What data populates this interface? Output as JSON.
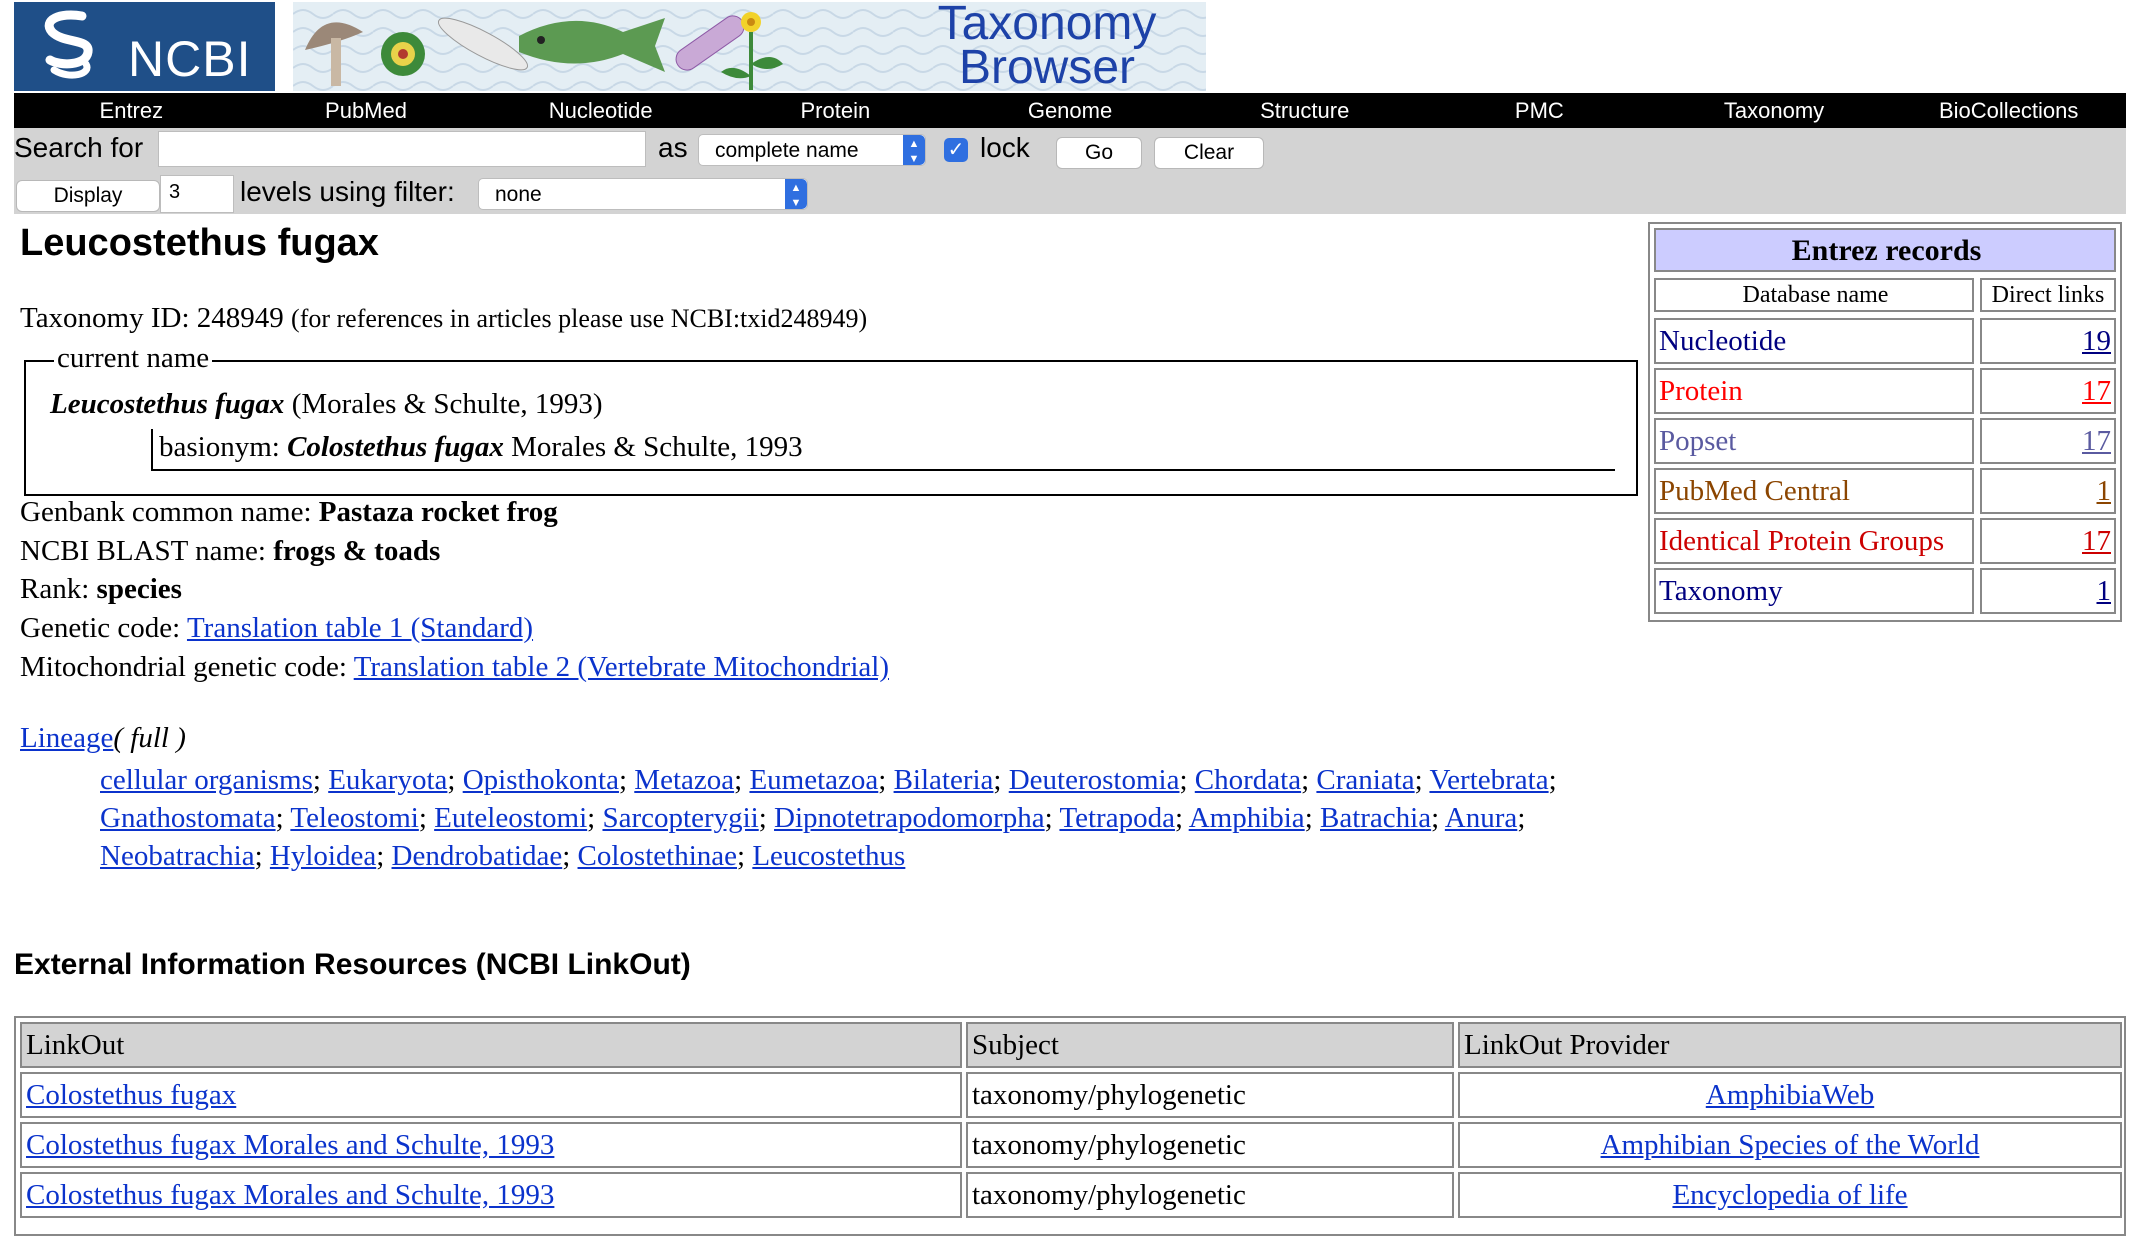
{
  "header": {
    "logo_text": "NCBI",
    "banner_title_line1": "Taxonomy",
    "banner_title_line2": "Browser"
  },
  "nav": {
    "items": [
      "Entrez",
      "PubMed",
      "Nucleotide",
      "Protein",
      "Genome",
      "Structure",
      "PMC",
      "Taxonomy",
      "BioCollections"
    ]
  },
  "search": {
    "label": "Search for",
    "value": "",
    "as_label": "as",
    "as_value": "complete name",
    "lock_label": "lock",
    "lock_checked": true,
    "go_label": "Go",
    "clear_label": "Clear",
    "display_label": "Display",
    "levels_value": "3",
    "levels_label": "levels using filter:",
    "filter_value": "none"
  },
  "taxon": {
    "name": "Leucostethus fugax",
    "taxonomy_id_label": "Taxonomy ID: 248949",
    "taxonomy_id_note": "(for references in articles please use NCBI:txid248949)",
    "current_name_legend": "current name",
    "current_name": "Leucostethus fugax",
    "current_name_authority": "(Morales & Schulte, 1993)",
    "basionym_label": "basionym:",
    "basionym_name": "Colostethus fugax",
    "basionym_authority": "Morales & Schulte, 1993",
    "genbank_label": "Genbank common name:",
    "genbank_value": "Pastaza rocket frog",
    "blast_label": "NCBI BLAST name:",
    "blast_value": "frogs & toads",
    "rank_label": "Rank:",
    "rank_value": "species",
    "genetic_code_label": "Genetic code:",
    "genetic_code_value": "Translation table 1 (Standard)",
    "mito_code_label": "Mitochondrial genetic code:",
    "mito_code_value": "Translation table 2 (Vertebrate Mitochondrial)"
  },
  "lineage": {
    "label": "Lineage",
    "full_label": "( full )",
    "items": [
      "cellular organisms",
      "Eukaryota",
      "Opisthokonta",
      "Metazoa",
      "Eumetazoa",
      "Bilateria",
      "Deuterostomia",
      "Chordata",
      "Craniata",
      "Vertebrata",
      "Gnathostomata",
      "Teleostomi",
      "Euteleostomi",
      "Sarcopterygii",
      "Dipnotetrapodomorpha",
      "Tetrapoda",
      "Amphibia",
      "Batrachia",
      "Anura",
      "Neobatrachia",
      "Hyloidea",
      "Dendrobatidae",
      "Colostethinae",
      "Leucostethus"
    ]
  },
  "entrez": {
    "title": "Entrez records",
    "col_db": "Database name",
    "col_links": "Direct links",
    "rows": [
      {
        "name": "Nucleotide",
        "count": "19",
        "color": "#000080"
      },
      {
        "name": "Protein",
        "count": "17",
        "color": "#ff0000"
      },
      {
        "name": "Popset",
        "count": "17",
        "color": "#5a5aa0"
      },
      {
        "name": "PubMed Central",
        "count": "1",
        "color": "#8b4500"
      },
      {
        "name": "Identical Protein Groups",
        "count": "17",
        "color": "#cc0000"
      },
      {
        "name": "Taxonomy",
        "count": "1",
        "color": "#000080"
      }
    ]
  },
  "linkout": {
    "heading": "External Information Resources (NCBI LinkOut)",
    "col_linkout": "LinkOut",
    "col_subject": "Subject",
    "col_provider": "LinkOut Provider",
    "rows": [
      {
        "link": "Colostethus fugax",
        "subject": "taxonomy/phylogenetic",
        "provider": "AmphibiaWeb"
      },
      {
        "link": "Colostethus fugax Morales and Schulte, 1993",
        "subject": "taxonomy/phylogenetic",
        "provider": "Amphibian Species of the World"
      },
      {
        "link": "Colostethus fugax Morales and Schulte, 1993",
        "subject": "taxonomy/phylogenetic",
        "provider": "Encyclopedia of life"
      }
    ]
  },
  "colors": {
    "header_black": "#000000",
    "searchbar_gray": "#d3d3d3",
    "entrez_title_bg": "#ccccff",
    "link_blue": "#0b33cc",
    "logo_blue": "#1f4f88"
  }
}
